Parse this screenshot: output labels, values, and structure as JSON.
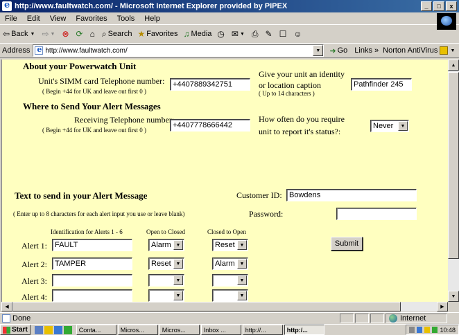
{
  "window": {
    "title": "http://www.faultwatch.com/ - Microsoft Internet Explorer provided by PIPEX",
    "min": "_",
    "max": "□",
    "close": "x"
  },
  "menu": [
    "File",
    "Edit",
    "View",
    "Favorites",
    "Tools",
    "Help"
  ],
  "toolbar": {
    "back": "Back",
    "search": "Search",
    "favorites": "Favorites",
    "media": "Media"
  },
  "address": {
    "label": "Address",
    "url": "http://www.faultwatch.com/",
    "go": "Go",
    "links": "Links",
    "norton": "Norton AntiVirus"
  },
  "form": {
    "about_heading": "About your Powerwatch Unit",
    "simm_label": "Unit's SIMM card Telephone number:",
    "simm_hint": "( Begin +44 for UK and leave out first 0 )",
    "simm_value": "+4407889342751",
    "identity_label_1": "Give your unit an identity",
    "identity_label_2": "or location caption",
    "identity_hint": "( Up to 14 characters )",
    "identity_value": "Pathfinder 245",
    "send_heading": "Where to Send Your Alert Messages",
    "receiving_label": "Receiving Telephone number:",
    "receiving_hint": "( Begin +44 for UK and leave out first 0 )",
    "receiving_value": "+4407778666442",
    "status_label_1": "How often do you require",
    "status_label_2": "unit to report it's status?:",
    "status_value": "Never",
    "alert_heading": "Text to send in your Alert Message",
    "alert_hint": "( Enter up to 8 characters for each alert input you use or leave blank)",
    "customer_label": "Customer ID:",
    "customer_value": "Bowdens",
    "password_label": "Password:",
    "password_value": "",
    "col_ident": "Identification for Alerts 1 - 6",
    "col_otc": "Open to Closed",
    "col_cto": "Closed to Open",
    "submit": "Submit",
    "alerts": [
      {
        "label": "Alert 1:",
        "text": "FAULT",
        "otc": "Alarm",
        "cto": "Reset"
      },
      {
        "label": "Alert 2:",
        "text": "TAMPER",
        "otc": "Reset",
        "cto": "Alarm"
      },
      {
        "label": "Alert 3:",
        "text": "",
        "otc": "",
        "cto": ""
      },
      {
        "label": "Alert 4:",
        "text": "",
        "otc": "",
        "cto": ""
      }
    ]
  },
  "status": {
    "text": "Done",
    "zone": "Internet"
  },
  "taskbar": {
    "start": "Start",
    "tasks": [
      "Conta...",
      "Micros...",
      "Micros...",
      "Inbox ...",
      "http://...",
      "http:/..."
    ],
    "clock": "10:48"
  }
}
